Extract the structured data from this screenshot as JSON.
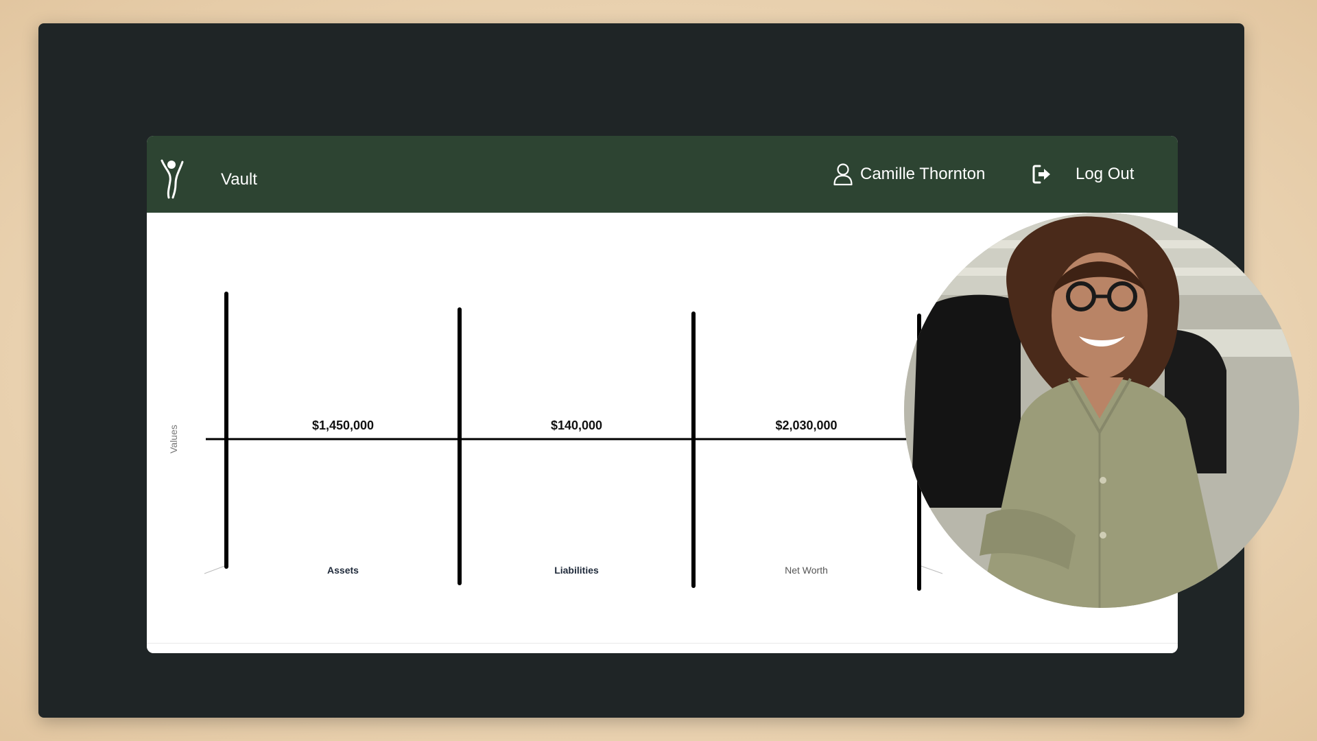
{
  "navbar": {
    "brand_name": "Vault",
    "user_name": "Camille Thornton",
    "logout_label": "Log Out"
  },
  "icons": {
    "logo": "figure-logo-icon",
    "user": "user-icon",
    "logout": "logout-icon"
  },
  "colors": {
    "navbar_background": "#2d4432",
    "frame_background": "#1f2526",
    "page_background": "#ecd6b6",
    "chart_ink": "#000000",
    "category_label": "#1f2a3a"
  },
  "chart_data": {
    "type": "bar",
    "ylabel": "Values",
    "categories": [
      "Assets",
      "Liabilities",
      "Net Worth"
    ],
    "data_labels": [
      "$1,450,000",
      "$140,000",
      "$2,030,000"
    ],
    "values": [
      1450000,
      140000,
      2030000
    ]
  },
  "overlay": {
    "photo": "presenter-portrait-photo"
  }
}
